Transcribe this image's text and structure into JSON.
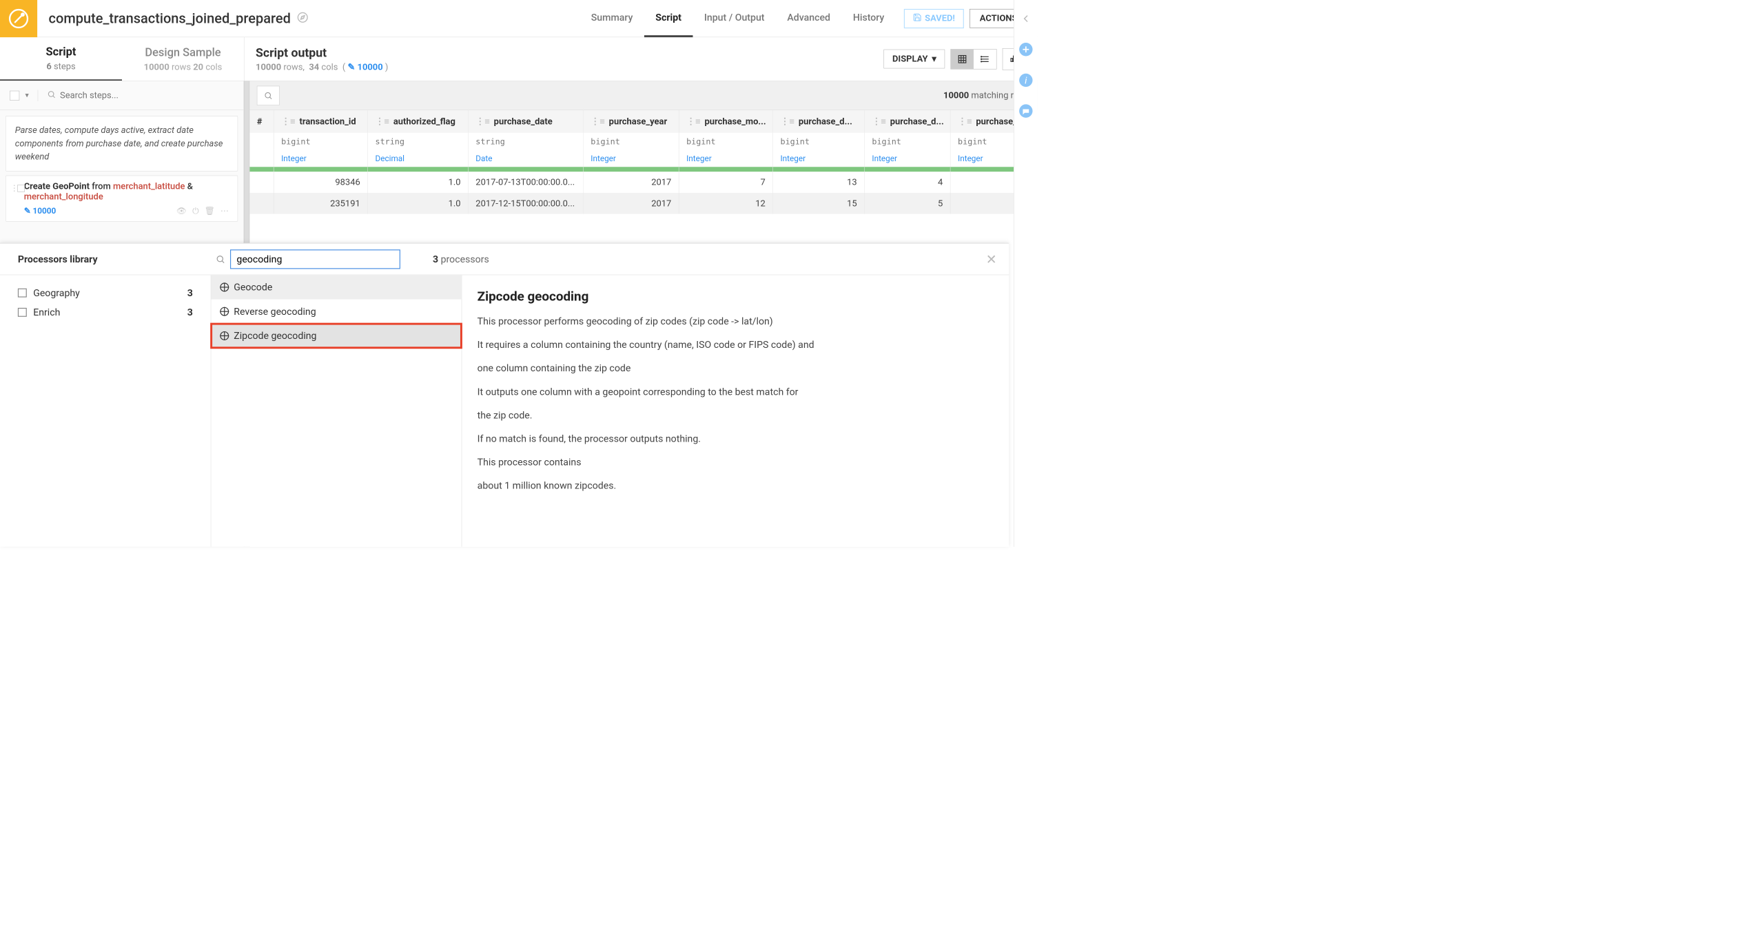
{
  "header": {
    "title": "compute_transactions_joined_prepared",
    "tabs": [
      "Summary",
      "Script",
      "Input / Output",
      "Advanced",
      "History"
    ],
    "active_tab": 1,
    "saved": "SAVED!",
    "actions": "ACTIONS"
  },
  "sub": {
    "script_tab": "Script",
    "script_meta_n": "6",
    "script_meta_label": "steps",
    "design_tab": "Design Sample",
    "design_rows": "10000",
    "design_rows_label": "rows",
    "design_cols": "20",
    "design_cols_label": "cols",
    "output_title": "Script output",
    "output_rows": "10000",
    "output_rows_label": "rows,",
    "output_cols": "34",
    "output_cols_label": "cols",
    "edit_link": "10000",
    "display": "DISPLAY"
  },
  "steps": {
    "search_placeholder": "Search steps...",
    "group_desc": "Parse dates, compute days active, extract date components from purchase date, and create purchase weekend",
    "step2_a": "Create GeoPoint",
    "step2_b": "from",
    "step2_lat": "merchant_latitude",
    "step2_amp": "&",
    "step2_lon": "merchant_longitude",
    "step2_count": "10000"
  },
  "table": {
    "matching_n": "10000",
    "matching_label": "matching rows",
    "cols": [
      {
        "name": "transaction_id",
        "type": "bigint",
        "meaning": "Integer"
      },
      {
        "name": "authorized_flag",
        "type": "string",
        "meaning": "Decimal"
      },
      {
        "name": "purchase_date",
        "type": "string",
        "meaning": "Date"
      },
      {
        "name": "purchase_year",
        "type": "bigint",
        "meaning": "Integer"
      },
      {
        "name": "purchase_mo...",
        "type": "bigint",
        "meaning": "Integer"
      },
      {
        "name": "purchase_d...",
        "type": "bigint",
        "meaning": "Integer"
      },
      {
        "name": "purchase_d...",
        "type": "bigint",
        "meaning": "Integer"
      },
      {
        "name": "purchase_w...",
        "type": "bigint",
        "meaning": "Integer"
      }
    ],
    "rows": [
      [
        "98346",
        "1.0",
        "2017-07-13T00:00:00.0...",
        "2017",
        "7",
        "13",
        "4",
        ""
      ],
      [
        "235191",
        "1.0",
        "2017-12-15T00:00:00.0...",
        "2017",
        "12",
        "15",
        "5",
        ""
      ]
    ]
  },
  "proc": {
    "title": "Processors library",
    "search_value": "geocoding",
    "count_n": "3",
    "count_label": "processors",
    "cats": [
      {
        "name": "Geography",
        "count": "3"
      },
      {
        "name": "Enrich",
        "count": "3"
      }
    ],
    "items": [
      "Geocode",
      "Reverse geocoding",
      "Zipcode geocoding"
    ],
    "selected": 2,
    "detail_title": "Zipcode geocoding",
    "detail_paras": [
      "This processor performs geocoding of zip codes (zip code -> lat/lon)",
      "It requires a column containing the country (name, ISO code or FIPS code) and",
      "one column containing the zip code",
      "It outputs one column with a geopoint corresponding to the best match for",
      "the zip code.",
      "If no match is found, the processor outputs nothing.",
      "This processor contains",
      "about 1 million known zipcodes."
    ]
  }
}
